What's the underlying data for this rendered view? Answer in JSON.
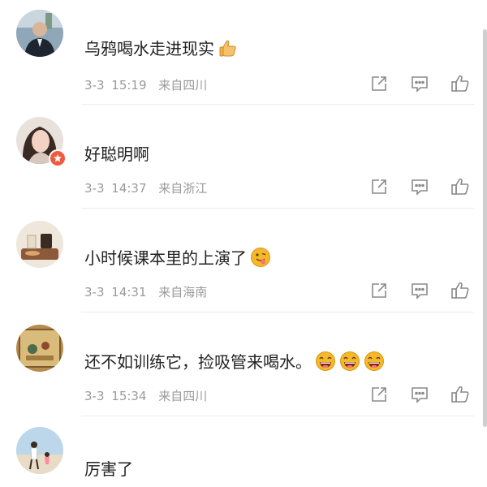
{
  "comments": [
    {
      "text": "乌鸦喝水走进现实",
      "emoji": "thumbs-up-emoji",
      "date": "3-3",
      "time": "15:19",
      "location": "来自四川"
    },
    {
      "text": "好聪明啊",
      "date": "3-3",
      "time": "14:37",
      "location": "来自浙江"
    },
    {
      "text": "小时候课本里的上演了",
      "emoji": "tongue-out-emoji",
      "date": "3-3",
      "time": "14:31",
      "location": "来自海南"
    },
    {
      "text": "还不如训练它，捡吸管来喝水。",
      "emoji": "laughing-emoji",
      "emoji_count": 3,
      "date": "3-3",
      "time": "15:34",
      "location": "来自四川"
    },
    {
      "text": "厉害了"
    }
  ],
  "icons": {
    "repost": "repost-icon",
    "comment": "comment-icon",
    "like": "like-icon"
  },
  "colors": {
    "text": "#222222",
    "meta": "#9a9a9a",
    "icon": "#8a8a8a",
    "badge": "#ef5b3f",
    "emoji": "#f5b829"
  }
}
